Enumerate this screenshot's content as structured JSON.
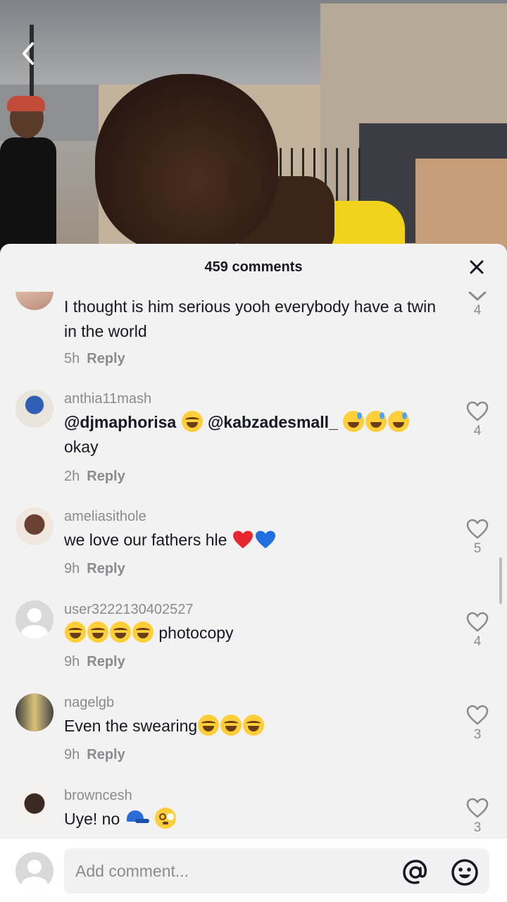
{
  "header": {
    "title": "459 comments",
    "close_icon": "close-icon",
    "back_icon": "chevron-left-icon"
  },
  "comments": [
    {
      "avatar": "avatar-partial",
      "username": "",
      "text": "I thought is him serious yooh everybody have a twin in the world",
      "time": "5h",
      "reply_label": "Reply",
      "like_icon": "chevron-down-icon",
      "likes": "4"
    },
    {
      "avatar": "avatar",
      "username": "anthia11mash",
      "mention1": "@djmaphorisa",
      "mention2": "@kabzadesmall_",
      "text_after": "okay",
      "time": "2h",
      "reply_label": "Reply",
      "like_icon": "heart-outline-icon",
      "likes": "4"
    },
    {
      "avatar": "avatar",
      "username": "ameliasithole",
      "text": "we love our fathers hle",
      "time": "9h",
      "reply_label": "Reply",
      "like_icon": "heart-outline-icon",
      "likes": "5"
    },
    {
      "avatar": "default-avatar",
      "username": "user3222130402527",
      "text": "photocopy",
      "time": "9h",
      "reply_label": "Reply",
      "like_icon": "heart-outline-icon",
      "likes": "4"
    },
    {
      "avatar": "avatar",
      "username": "nagelgb",
      "text": "Even the swearing",
      "time": "9h",
      "reply_label": "Reply",
      "like_icon": "heart-outline-icon",
      "likes": "3"
    },
    {
      "avatar": "avatar",
      "username": "browncesh",
      "text": "Uye! no",
      "time": "",
      "reply_label": "",
      "like_icon": "heart-outline-icon",
      "likes": "3"
    }
  ],
  "input": {
    "placeholder": "Add comment...",
    "mention_icon": "at-icon",
    "emoji_icon": "emoji-icon"
  },
  "colors": {
    "sheet_bg": "#f2f2f2",
    "text_primary": "#161823",
    "text_secondary": "#8a8b91",
    "shirt_yellow": "#f2d31b"
  }
}
